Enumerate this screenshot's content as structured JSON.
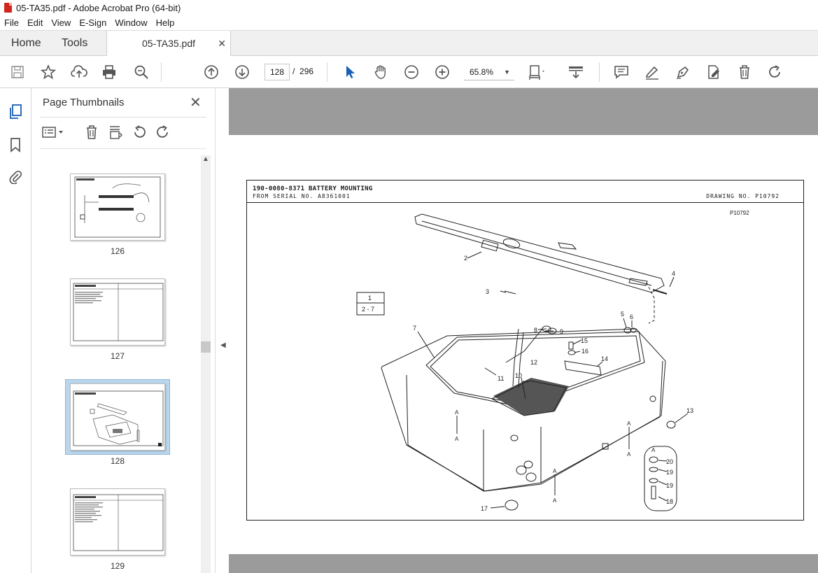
{
  "window": {
    "title": "05-TA35.pdf - Adobe Acrobat Pro (64-bit)"
  },
  "menu": [
    "File",
    "Edit",
    "View",
    "E-Sign",
    "Window",
    "Help"
  ],
  "tabs": {
    "home": "Home",
    "tools": "Tools",
    "document": "05-TA35.pdf",
    "close": "✕"
  },
  "toolbar": {
    "current_page": "128",
    "page_separator": "/",
    "total_pages": "296",
    "zoom": "65.8%"
  },
  "panel": {
    "title": "Page Thumbnails",
    "thumbnails": [
      {
        "label": "126",
        "selected": false
      },
      {
        "label": "127",
        "selected": false
      },
      {
        "label": "128",
        "selected": true
      },
      {
        "label": "129",
        "selected": false
      }
    ]
  },
  "document": {
    "title_line": "190-0080-8371 BATTERY MOUNTING",
    "serial_prefix": "FROM SERIAL NO.",
    "serial": "A8361001",
    "drawing_prefix": "DRAWING NO.",
    "drawing_no": "P10792",
    "plate_id": "P10792",
    "ref_box": [
      "1",
      "2 - 7"
    ],
    "callouts": [
      "2",
      "3",
      "4",
      "5",
      "6",
      "7",
      "8",
      "9",
      "10",
      "11",
      "12",
      "13",
      "14",
      "15",
      "16",
      "17",
      "18",
      "19",
      "19",
      "20"
    ],
    "section_letter": "A"
  }
}
